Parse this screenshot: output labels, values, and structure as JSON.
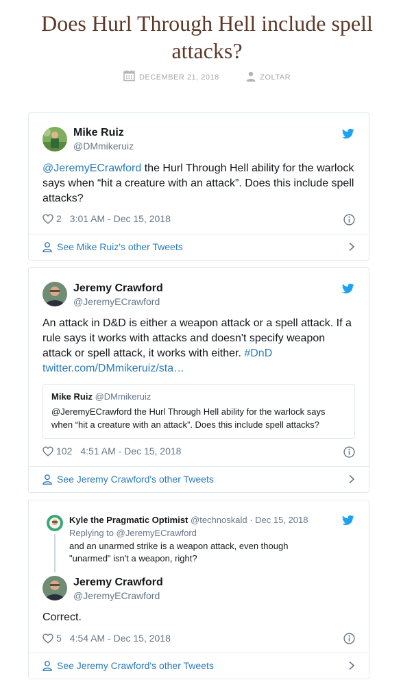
{
  "page": {
    "title": "Does Hurl Through Hell include spell attacks?",
    "date": "DECEMBER 21, 2018",
    "author": "ZOLTAR"
  },
  "tweets": [
    {
      "name": "Mike Ruiz",
      "handle": "@DMmikeruiz",
      "mention": "@JeremyECrawford",
      "text": " the Hurl Through Hell ability for the warlock says when “hit a creature with an attack”. Does this include spell attacks?",
      "likes": "2",
      "time": "3:01 AM - Dec 15, 2018",
      "more": "See Mike Ruiz's other Tweets"
    },
    {
      "name": "Jeremy Crawford",
      "handle": "@JeremyECrawford",
      "text": "An attack in D&D is either a weapon attack or a spell attack. If a rule says it works with attacks and doesn't specify weapon attack or spell attack, it works with either. ",
      "hashtag": "#DnD",
      "link": "twitter.com/DMmikeruiz/sta…",
      "quote": {
        "name": "Mike Ruiz",
        "handle": "@DMmikeruiz",
        "text": "@JeremyECrawford the Hurl Through Hell ability for the warlock says when “hit a creature with an attack”. Does this include spell attacks?"
      },
      "likes": "102",
      "time": "4:51 AM - Dec 15, 2018",
      "more": "See Jeremy Crawford's other Tweets"
    },
    {
      "parent": {
        "name": "Kyle the Pragmatic Optimist",
        "handle": "@technoskald",
        "date": "· Dec 15, 2018",
        "replying": "Replying to @JeremyECrawford",
        "text": "and an unarmed strike is a weapon attack, even though \"unarmed\" isn't a weapon, right?"
      },
      "name": "Jeremy Crawford",
      "handle": "@JeremyECrawford",
      "text": "Correct.",
      "likes": "5",
      "time": "4:54 AM - Dec 15, 2018",
      "more": "See Jeremy Crawford's other Tweets"
    }
  ],
  "colors": {
    "title": "#5b3a29",
    "link": "#2b7bb9",
    "twitter_blue": "#1da1f2",
    "muted": "#657786"
  },
  "icons": [
    "calendar-icon",
    "person-icon",
    "twitter-bird-icon",
    "heart-icon",
    "info-icon",
    "person-outline-icon",
    "chevron-right-icon"
  ]
}
